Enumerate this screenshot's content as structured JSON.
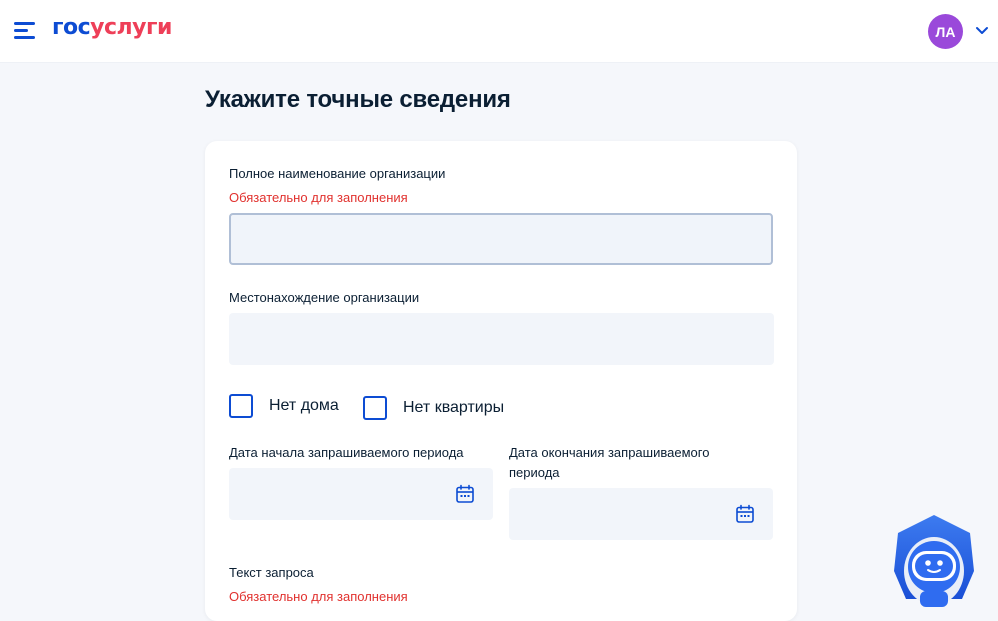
{
  "header": {
    "logo_part1": "гос",
    "logo_part2": "услуги",
    "avatar_initials": "ЛА"
  },
  "page": {
    "title": "Укажите точные сведения"
  },
  "form": {
    "org_name": {
      "label": "Полное наименование организации",
      "required_text": "Обязательно для заполнения",
      "value": ""
    },
    "org_location": {
      "label": "Местонахождение организации",
      "value": ""
    },
    "no_house_label": "Нет дома",
    "no_apartment_label": "Нет квартиры",
    "start_date": {
      "label": "Дата начала запрашиваемого периода",
      "value": ""
    },
    "end_date": {
      "label": "Дата окончания запрашиваемого периода",
      "value": ""
    },
    "request_text": {
      "label": "Текст запроса",
      "required_text": "Обязательно для заполнения"
    }
  },
  "colors": {
    "brand_blue": "#0d4cd3",
    "brand_red": "#ee3f58",
    "required_red": "#e1312e",
    "avatar_purple": "#9a49da"
  }
}
